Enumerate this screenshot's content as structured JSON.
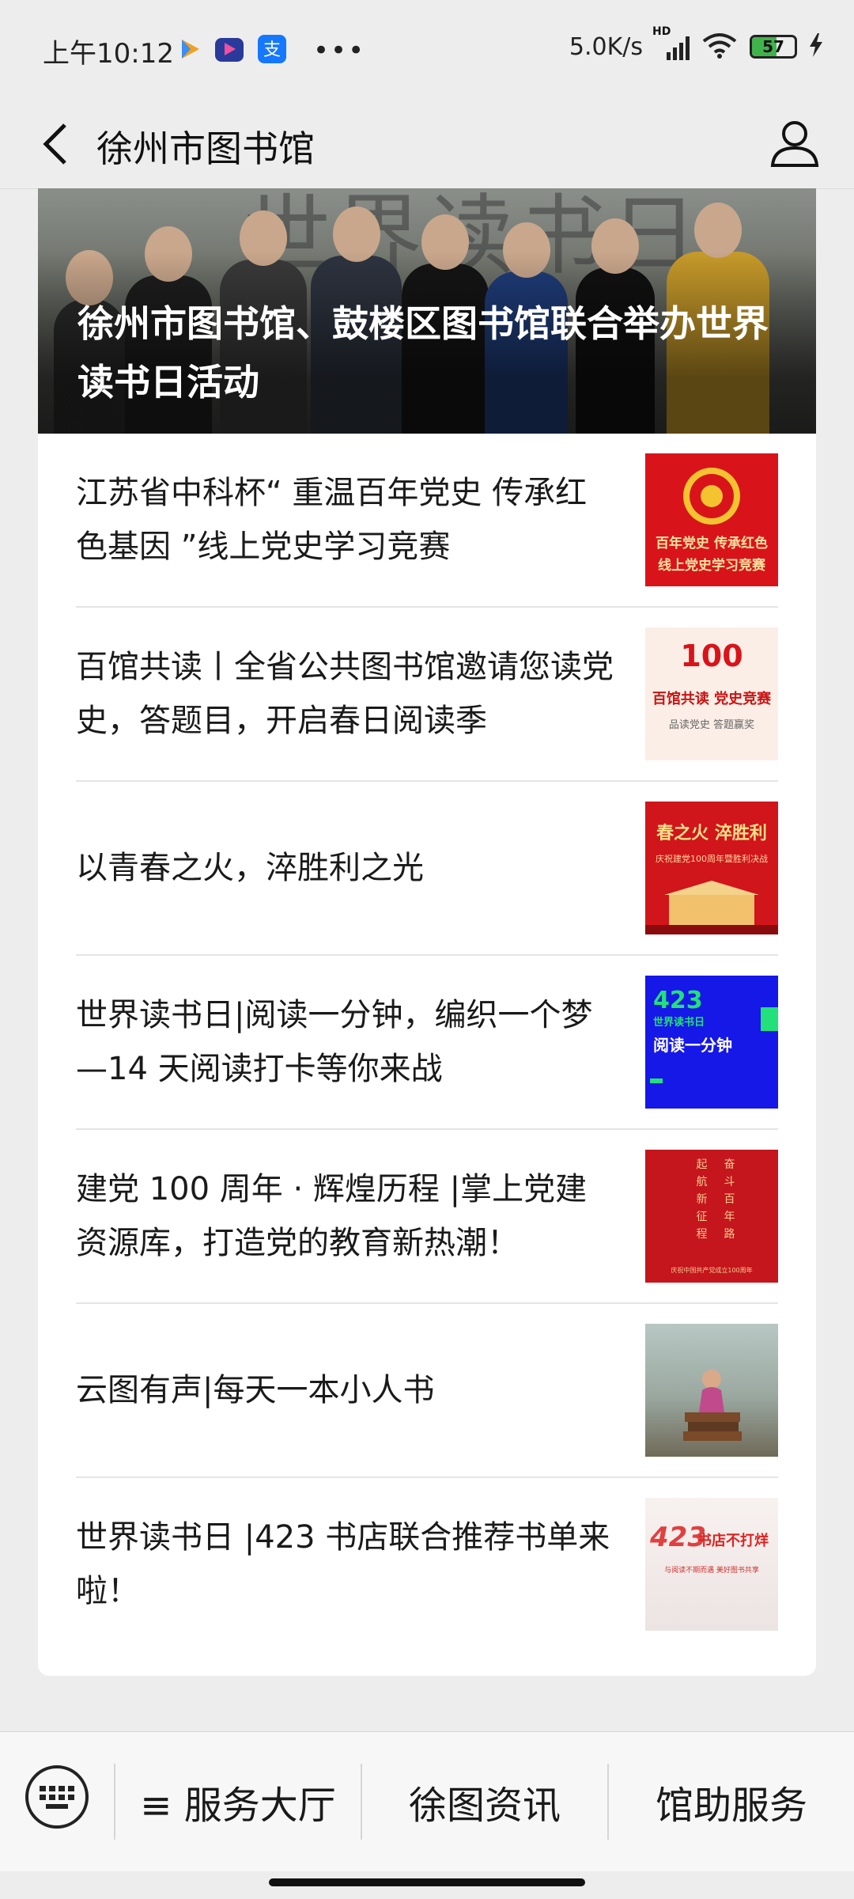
{
  "status_bar": {
    "time": "上午10:12",
    "net_speed": "5.0K/s",
    "network_tag": "HD",
    "battery_level": "57",
    "battery_fraction": 0.57
  },
  "nav": {
    "title": "徐州市图书馆"
  },
  "featured": {
    "title": "徐州市图书馆、鼓楼区图书馆联合举办世界读书日活动",
    "bg_text": "世界读书日"
  },
  "news": [
    {
      "title": "江苏省中科杯“ 重温百年党史 传承红色基因 ”线上党史学习竞赛",
      "thumb_lines": [
        "百年党史 传承红色",
        "线上党史学习竞赛"
      ]
    },
    {
      "title": "百馆共读丨全省公共图书馆邀请您读党史，答题目，开启春日阅读季",
      "thumb_lines": [
        "100",
        "百馆共读 党史竞赛",
        "品读党史 答题赢奖"
      ]
    },
    {
      "title": "以青春之火，淬胜利之光",
      "thumb_lines": [
        "春之火 淬胜利",
        "庆祝建党100周年暨胜利决战"
      ]
    },
    {
      "title": "世界读书日|阅读一分钟，编织一个梦 —14 天阅读打卡等你来战",
      "thumb_lines": [
        "423",
        "世界读书日",
        "阅读一分钟"
      ]
    },
    {
      "title": "建党 100 周年 · 辉煌历程 |掌上党建资源库，打造党的教育新热潮！",
      "thumb_lines": [
        "起",
        "奋",
        "航",
        "斗",
        "新",
        "百",
        "征",
        "年",
        "程",
        "路",
        "庆祝中国共产党成立100周年"
      ]
    },
    {
      "title": "云图有声|每天一本小人书",
      "thumb_lines": []
    },
    {
      "title": "世界读书日 |423 书店联合推荐书单来啦！",
      "thumb_lines": [
        "423",
        "书店不打烊",
        "与阅读不期而遇 美好图书共享"
      ]
    }
  ],
  "bottom_menu": {
    "items": [
      "≡ 服务大厅",
      "徐图资讯",
      "馆助服务"
    ]
  },
  "colors": {
    "background": "#ededed",
    "card": "#ffffff",
    "party_red": "#d8141a",
    "blue_thumb": "#1518e6"
  }
}
